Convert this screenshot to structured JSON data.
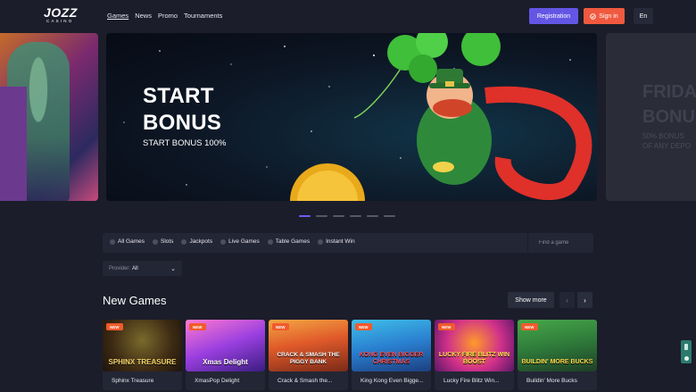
{
  "header": {
    "logo_main": "JOZZ",
    "logo_sub": "CASINO",
    "nav": [
      {
        "label": "Games",
        "active": true
      },
      {
        "label": "News",
        "active": false
      },
      {
        "label": "Promo",
        "active": false
      },
      {
        "label": "Tournaments",
        "active": false
      }
    ],
    "registration_label": "Registration",
    "signin_label": "Sign in",
    "language": "En"
  },
  "carousel": {
    "main": {
      "title_line1": "START",
      "title_line2": "BONUS",
      "subtitle": "START BONUS 100%"
    },
    "next": {
      "title_line1": "FRIDA",
      "title_line2": "BONU",
      "subtitle_line1": "50% BONUS",
      "subtitle_line2": "OF ANY DEPO"
    },
    "dots_count": 6,
    "active_dot": 0
  },
  "filters": {
    "categories": [
      "All Games",
      "Slots",
      "Jackpots",
      "Live Games",
      "Table Games",
      "Instant Win"
    ],
    "search_placeholder": "Find a game",
    "provider_label": "Provider:",
    "provider_value": "All"
  },
  "section": {
    "title": "New Games",
    "show_more_label": "Show more"
  },
  "games": [
    {
      "name": "Sphinx Treasure",
      "badge": "NEW",
      "art_text": "SPHINX TREASURE"
    },
    {
      "name": "XmasPop Delight",
      "badge": "NEW",
      "art_text": "Xmas Delight"
    },
    {
      "name": "Crack & Smash the...",
      "badge": "NEW",
      "art_text": "CRACK & SMASH THE PIGGY BANK"
    },
    {
      "name": "King Kong Even Bigge...",
      "badge": "NEW",
      "art_text": "KONG EVEN BIGGER CHRISTMAS"
    },
    {
      "name": "Lucky Fire Blitz Win...",
      "badge": "NEW",
      "art_text": "LUCKY FIRE BLITZ WIN BOOST"
    },
    {
      "name": "Buildin' More Bucks",
      "badge": "NEW",
      "art_text": "BUILDIN' MORE BUCKS"
    }
  ],
  "colors": {
    "background": "#1b1d2a",
    "registration": "#6356e5",
    "signin": "#f0593f",
    "active_dot": "#6b5ef0",
    "badge": "#f15a2b"
  }
}
